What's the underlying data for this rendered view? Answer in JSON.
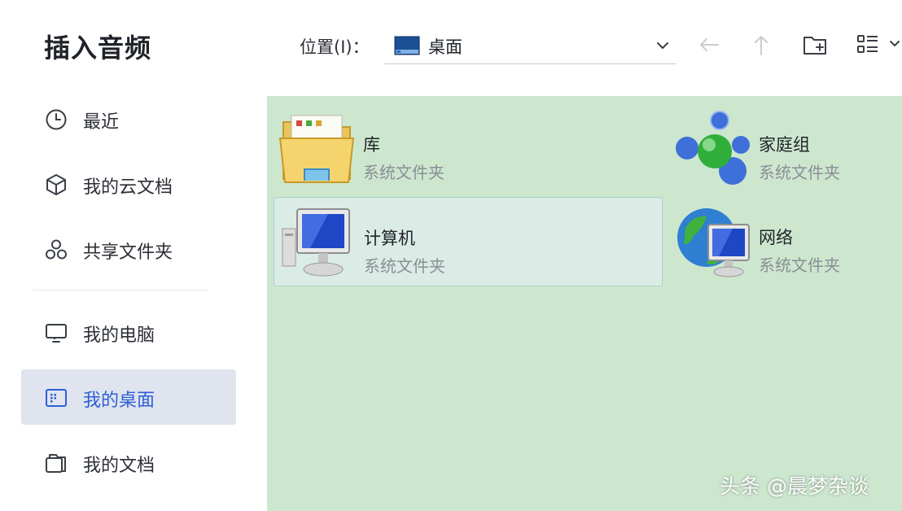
{
  "sidebar": {
    "title": "插入音频",
    "items": [
      {
        "label": "最近",
        "icon": "clock-icon"
      },
      {
        "label": "我的云文档",
        "icon": "cloud-doc-icon"
      },
      {
        "label": "共享文件夹",
        "icon": "share-folder-icon"
      },
      {
        "label": "我的电脑",
        "icon": "computer-icon"
      },
      {
        "label": "我的桌面",
        "icon": "desktop-icon",
        "active": true
      },
      {
        "label": "我的文档",
        "icon": "documents-icon"
      }
    ]
  },
  "toolbar": {
    "location_label": "位置(I)：",
    "location_value": "桌面",
    "icons": [
      "back-arrow-icon",
      "up-arrow-icon",
      "new-folder-icon",
      "view-mode-icon"
    ]
  },
  "content": {
    "items": [
      {
        "name": "库",
        "type": "系统文件夹",
        "icon": "library-folder-icon"
      },
      {
        "name": "家庭组",
        "type": "系统文件夹",
        "icon": "homegroup-icon"
      },
      {
        "name": "计算机",
        "type": "系统文件夹",
        "icon": "computer-icon",
        "selected": true
      },
      {
        "name": "网络",
        "type": "系统文件夹",
        "icon": "network-icon"
      }
    ]
  },
  "watermark": "头条 @晨梦杂谈",
  "colors": {
    "accent": "#2f5fd7",
    "content_bg": "#cde7cf",
    "selected_bg": "#dbebe5"
  }
}
